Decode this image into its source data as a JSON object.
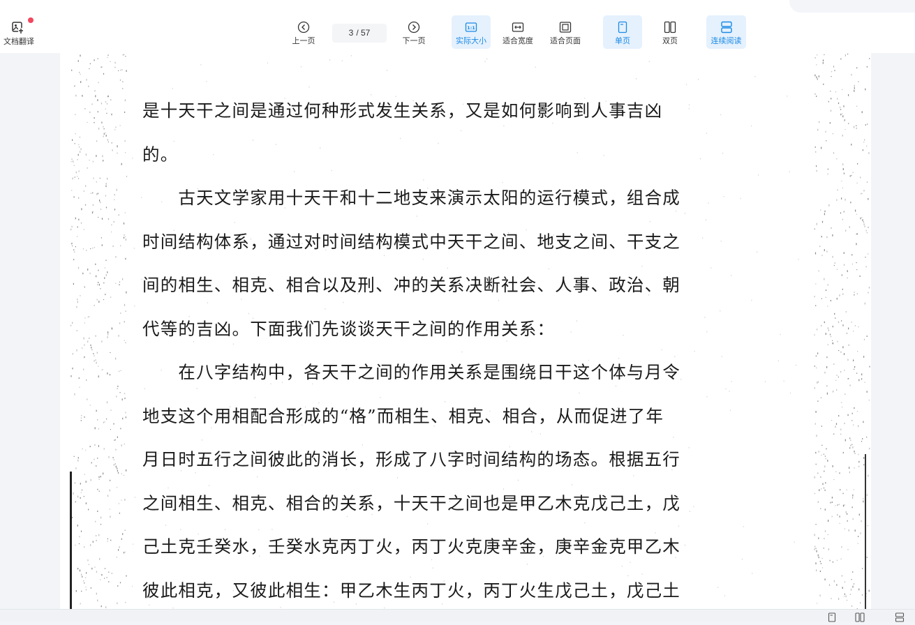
{
  "toolbar": {
    "translate": {
      "label": "文档翻译",
      "icon": "image-translate-icon",
      "badge_color": "#f2475f"
    },
    "prev_page": {
      "label": "上一页",
      "icon": "chevron-left-circle-icon"
    },
    "page_indicator": {
      "current": "3",
      "separator_total": "/ 57"
    },
    "next_page": {
      "label": "下一页",
      "icon": "chevron-right-circle-icon"
    },
    "actual_size": {
      "label": "实际大小",
      "icon": "actual-size-icon",
      "active": true
    },
    "fit_width": {
      "label": "适合宽度",
      "icon": "fit-width-icon"
    },
    "fit_page": {
      "label": "适合页面",
      "icon": "fit-page-icon"
    },
    "single_page": {
      "label": "单页",
      "icon": "single-page-icon",
      "active": true
    },
    "double_page": {
      "label": "双页",
      "icon": "double-page-icon"
    },
    "continuous": {
      "label": "连续阅读",
      "icon": "continuous-read-icon",
      "active": true
    }
  },
  "document": {
    "lines": [
      "是十天干之间是通过何种形式发生关系，又是如何影响到人事吉凶",
      "的。",
      "　　古天文学家用十天干和十二地支来演示太阳的运行模式，组合成",
      "时间结构体系，通过对时间结构模式中天干之间、地支之间、干支之",
      "间的相生、相克、相合以及刑、冲的关系决断社会、人事、政治、朝",
      "代等的吉凶。下面我们先谈谈天干之间的作用关系：",
      "　　在八字结构中，各天干之间的作用关系是围绕日干这个体与月令",
      "地支这个用相配合形成的“格”而相生、相克、相合，从而促进了年",
      "月日时五行之间彼此的消长，形成了八字时间结构的场态。根据五行",
      "之间相生、相克、相合的关系，十天干之间也是甲乙木克戊己土，戊",
      "己土克壬癸水，壬癸水克丙丁火，丙丁火克庚辛金，庚辛金克甲乙木",
      "彼此相克，又彼此相生：甲乙木生丙丁火，丙丁火生戊己土，戊己土"
    ]
  },
  "statusbar": {
    "icons": [
      "single-page-icon",
      "double-page-icon",
      "continuous-read-icon"
    ]
  },
  "colors": {
    "accent": "#1a8ae6",
    "active_bg": "#e5f1fd",
    "badge": "#f2475f"
  }
}
